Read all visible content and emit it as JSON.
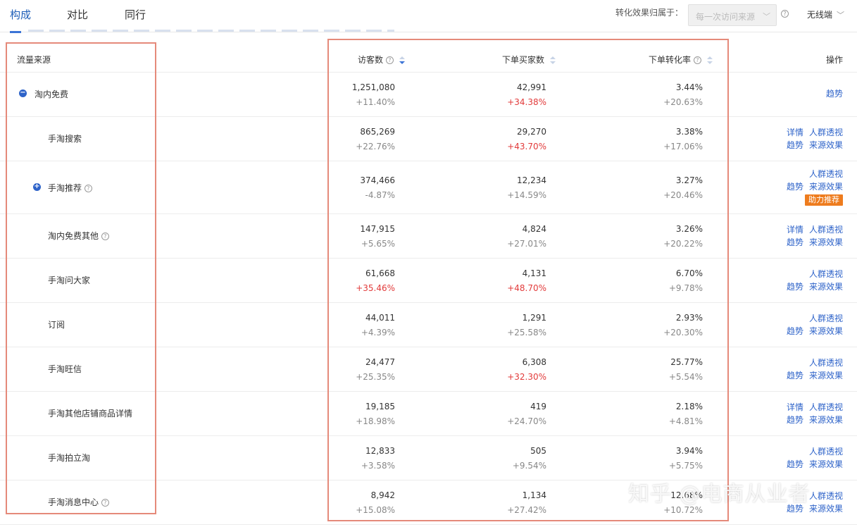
{
  "tabs": [
    {
      "label": "构成",
      "active": true
    },
    {
      "label": "对比",
      "active": false
    },
    {
      "label": "同行",
      "active": false
    }
  ],
  "controls": {
    "attribution_label": "转化效果归属于：",
    "attribution_value": "每一次访问来源",
    "device": "无线端"
  },
  "table": {
    "headers": {
      "source": "流量来源",
      "visitors": "访客数",
      "buyers": "下单买家数",
      "conversion": "下单转化率",
      "actions": "操作"
    },
    "rows": [
      {
        "source": "淘内免费",
        "visitors": "1,251,080",
        "visitors_change": "+11.40%",
        "buyers": "42,991",
        "buyers_change": "+34.38%",
        "conversion": "3.44%",
        "conversion_change": "+20.63%"
      },
      {
        "source": "手淘搜索",
        "visitors": "865,269",
        "visitors_change": "+22.76%",
        "buyers": "29,270",
        "buyers_change": "+43.70%",
        "conversion": "3.38%",
        "conversion_change": "+17.06%"
      },
      {
        "source": "手淘推荐",
        "visitors": "374,466",
        "visitors_change": "-4.87%",
        "buyers": "12,234",
        "buyers_change": "+14.59%",
        "conversion": "3.27%",
        "conversion_change": "+20.46%"
      },
      {
        "source": "淘内免费其他",
        "visitors": "147,915",
        "visitors_change": "+5.65%",
        "buyers": "4,824",
        "buyers_change": "+27.01%",
        "conversion": "3.26%",
        "conversion_change": "+20.22%"
      },
      {
        "source": "手淘问大家",
        "visitors": "61,668",
        "visitors_change": "+35.46%",
        "buyers": "4,131",
        "buyers_change": "+48.70%",
        "conversion": "6.70%",
        "conversion_change": "+9.78%"
      },
      {
        "source": "订阅",
        "visitors": "44,011",
        "visitors_change": "+4.39%",
        "buyers": "1,291",
        "buyers_change": "+25.58%",
        "conversion": "2.93%",
        "conversion_change": "+20.30%"
      },
      {
        "source": "手淘旺信",
        "visitors": "24,477",
        "visitors_change": "+25.35%",
        "buyers": "6,308",
        "buyers_change": "+32.30%",
        "conversion": "25.77%",
        "conversion_change": "+5.54%"
      },
      {
        "source": "手淘其他店铺商品详情",
        "visitors": "19,185",
        "visitors_change": "+18.98%",
        "buyers": "419",
        "buyers_change": "+24.70%",
        "conversion": "2.18%",
        "conversion_change": "+4.81%"
      },
      {
        "source": "手淘拍立淘",
        "visitors": "12,833",
        "visitors_change": "+3.58%",
        "buyers": "505",
        "buyers_change": "+9.54%",
        "conversion": "3.94%",
        "conversion_change": "+5.75%"
      },
      {
        "source": "手淘消息中心",
        "visitors": "8,942",
        "visitors_change": "+15.08%",
        "buyers": "1,134",
        "buyers_change": "+27.42%",
        "conversion": "12.68%",
        "conversion_change": "+10.72%"
      }
    ],
    "actions": {
      "detail": "详情",
      "crowd": "人群透视",
      "trend": "趋势",
      "effect": "来源效果",
      "boost": "助力推荐"
    }
  },
  "watermark": "知乎 @电商从业者",
  "colors": {
    "accent": "#2e63c9",
    "positive_highlight": "#e23b3b",
    "badge": "#ee7c1e",
    "annotation_box": "#e58a7a"
  }
}
